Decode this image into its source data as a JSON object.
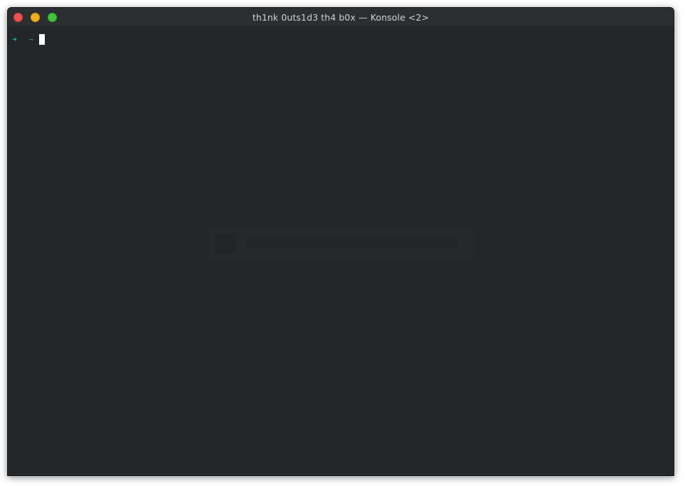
{
  "window": {
    "title": "th1nk 0uts1d3 th4 b0x — Konsole <2>"
  },
  "terminal": {
    "prompt_symbol": "➜",
    "cwd": "~"
  },
  "colors": {
    "background": "#232729",
    "titlebar": "#2b2f31",
    "prompt": "#1abc9c",
    "close": "#ec5050",
    "minimize": "#f3ae1e",
    "maximize": "#46c13e"
  },
  "icons": {
    "close": "close-icon",
    "minimize": "minimize-icon",
    "maximize": "maximize-icon"
  }
}
